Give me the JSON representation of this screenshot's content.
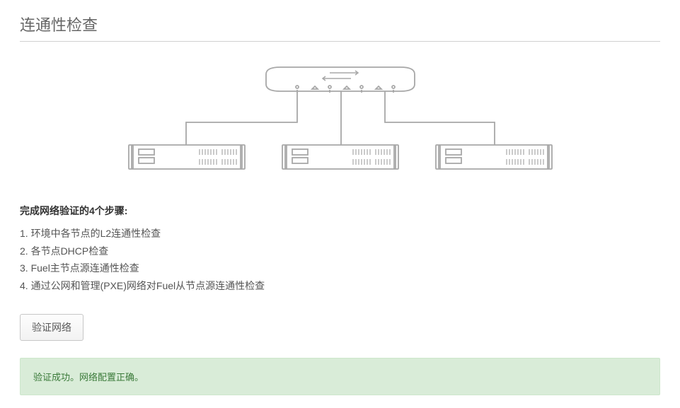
{
  "title": "连通性检查",
  "steps_heading": "完成网络验证的4个步骤:",
  "steps": [
    "1. 环境中各节点的L2连通性检查",
    "2. 各节点DHCP检查",
    "3. Fuel主节点源连通性检查",
    "4. 通过公网和管理(PXE)网络对Fuel从节点源连通性检查"
  ],
  "verify_button": "验证网络",
  "success_message": "验证成功。网络配置正确。"
}
